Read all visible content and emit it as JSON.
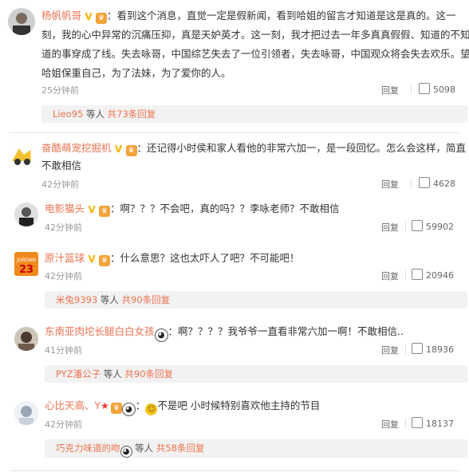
{
  "comments": [
    {
      "name": "杨帆帆哥",
      "text_lines": [
        "：看到这个消息，直觉一定是假新闻，看到哈姐的留言才知道是这是真的。这一",
        "刻，我的心中异常的沉痛压抑，真是天妒英才。这一刻，我才把过去一年多真真假假、知道的不知",
        "道的事穿成了线。失去咏哥，中国综艺失去了一位引领者，失去咏哥，中国观众将会失去欢乐。望",
        "哈姐保重自己，为了法妹，为了爱你的人。"
      ],
      "time": "25分钟前",
      "reply_label": "回复",
      "likes": "5098",
      "replies_summary": {
        "user": "Lieo95",
        "text": " 等人 ",
        "count": "共73条回复"
      }
    },
    {
      "name": "奋酷萌宠挖掘机",
      "text_lines": [
        "：还记得小时侯和家人看他的非常六加一，是一段回忆。怎么会这样，简直",
        "不敢相信"
      ],
      "time": "42分钟前",
      "reply_label": "回复",
      "likes": "4628"
    },
    {
      "name": "电影猫头",
      "text": "：啊？？？不会吧，真的吗？？李咏老师？不敢相信",
      "time": "42分钟前",
      "reply_label": "回复",
      "likes": "59902"
    },
    {
      "name": "原汁篮球",
      "text": "：什么意思？这也太吓人了吧？不可能吧！",
      "time": "42分钟前",
      "reply_label": "回复",
      "likes": "20946",
      "replies_summary": {
        "user": "米兔9393",
        "text": " 等人 ",
        "count": "共90条回复"
      }
    },
    {
      "name": "东南亚肉坨长腿白白女孩",
      "text": "：啊？？？？我爷爷一直看非常六加一啊！不敢相信..",
      "time": "41分钟前",
      "reply_label": "回复",
      "likes": "18936",
      "replies_summary": {
        "user": "PYZ潘公子",
        "text": " 等人 ",
        "count": "共90条回复"
      }
    },
    {
      "name": "心比天高、Y",
      "text": "不是吧 小时候特别喜欢他主持的节目",
      "time": "42分钟前",
      "reply_label": "回复",
      "likes": "18137",
      "replies_summary": {
        "user": "巧克力味道的吻",
        "text": " 等人 ",
        "count": "共58条回复"
      }
    }
  ],
  "colors": {
    "name": "#eb7350",
    "meta": "#999999",
    "subbg": "#f2f2f2"
  }
}
